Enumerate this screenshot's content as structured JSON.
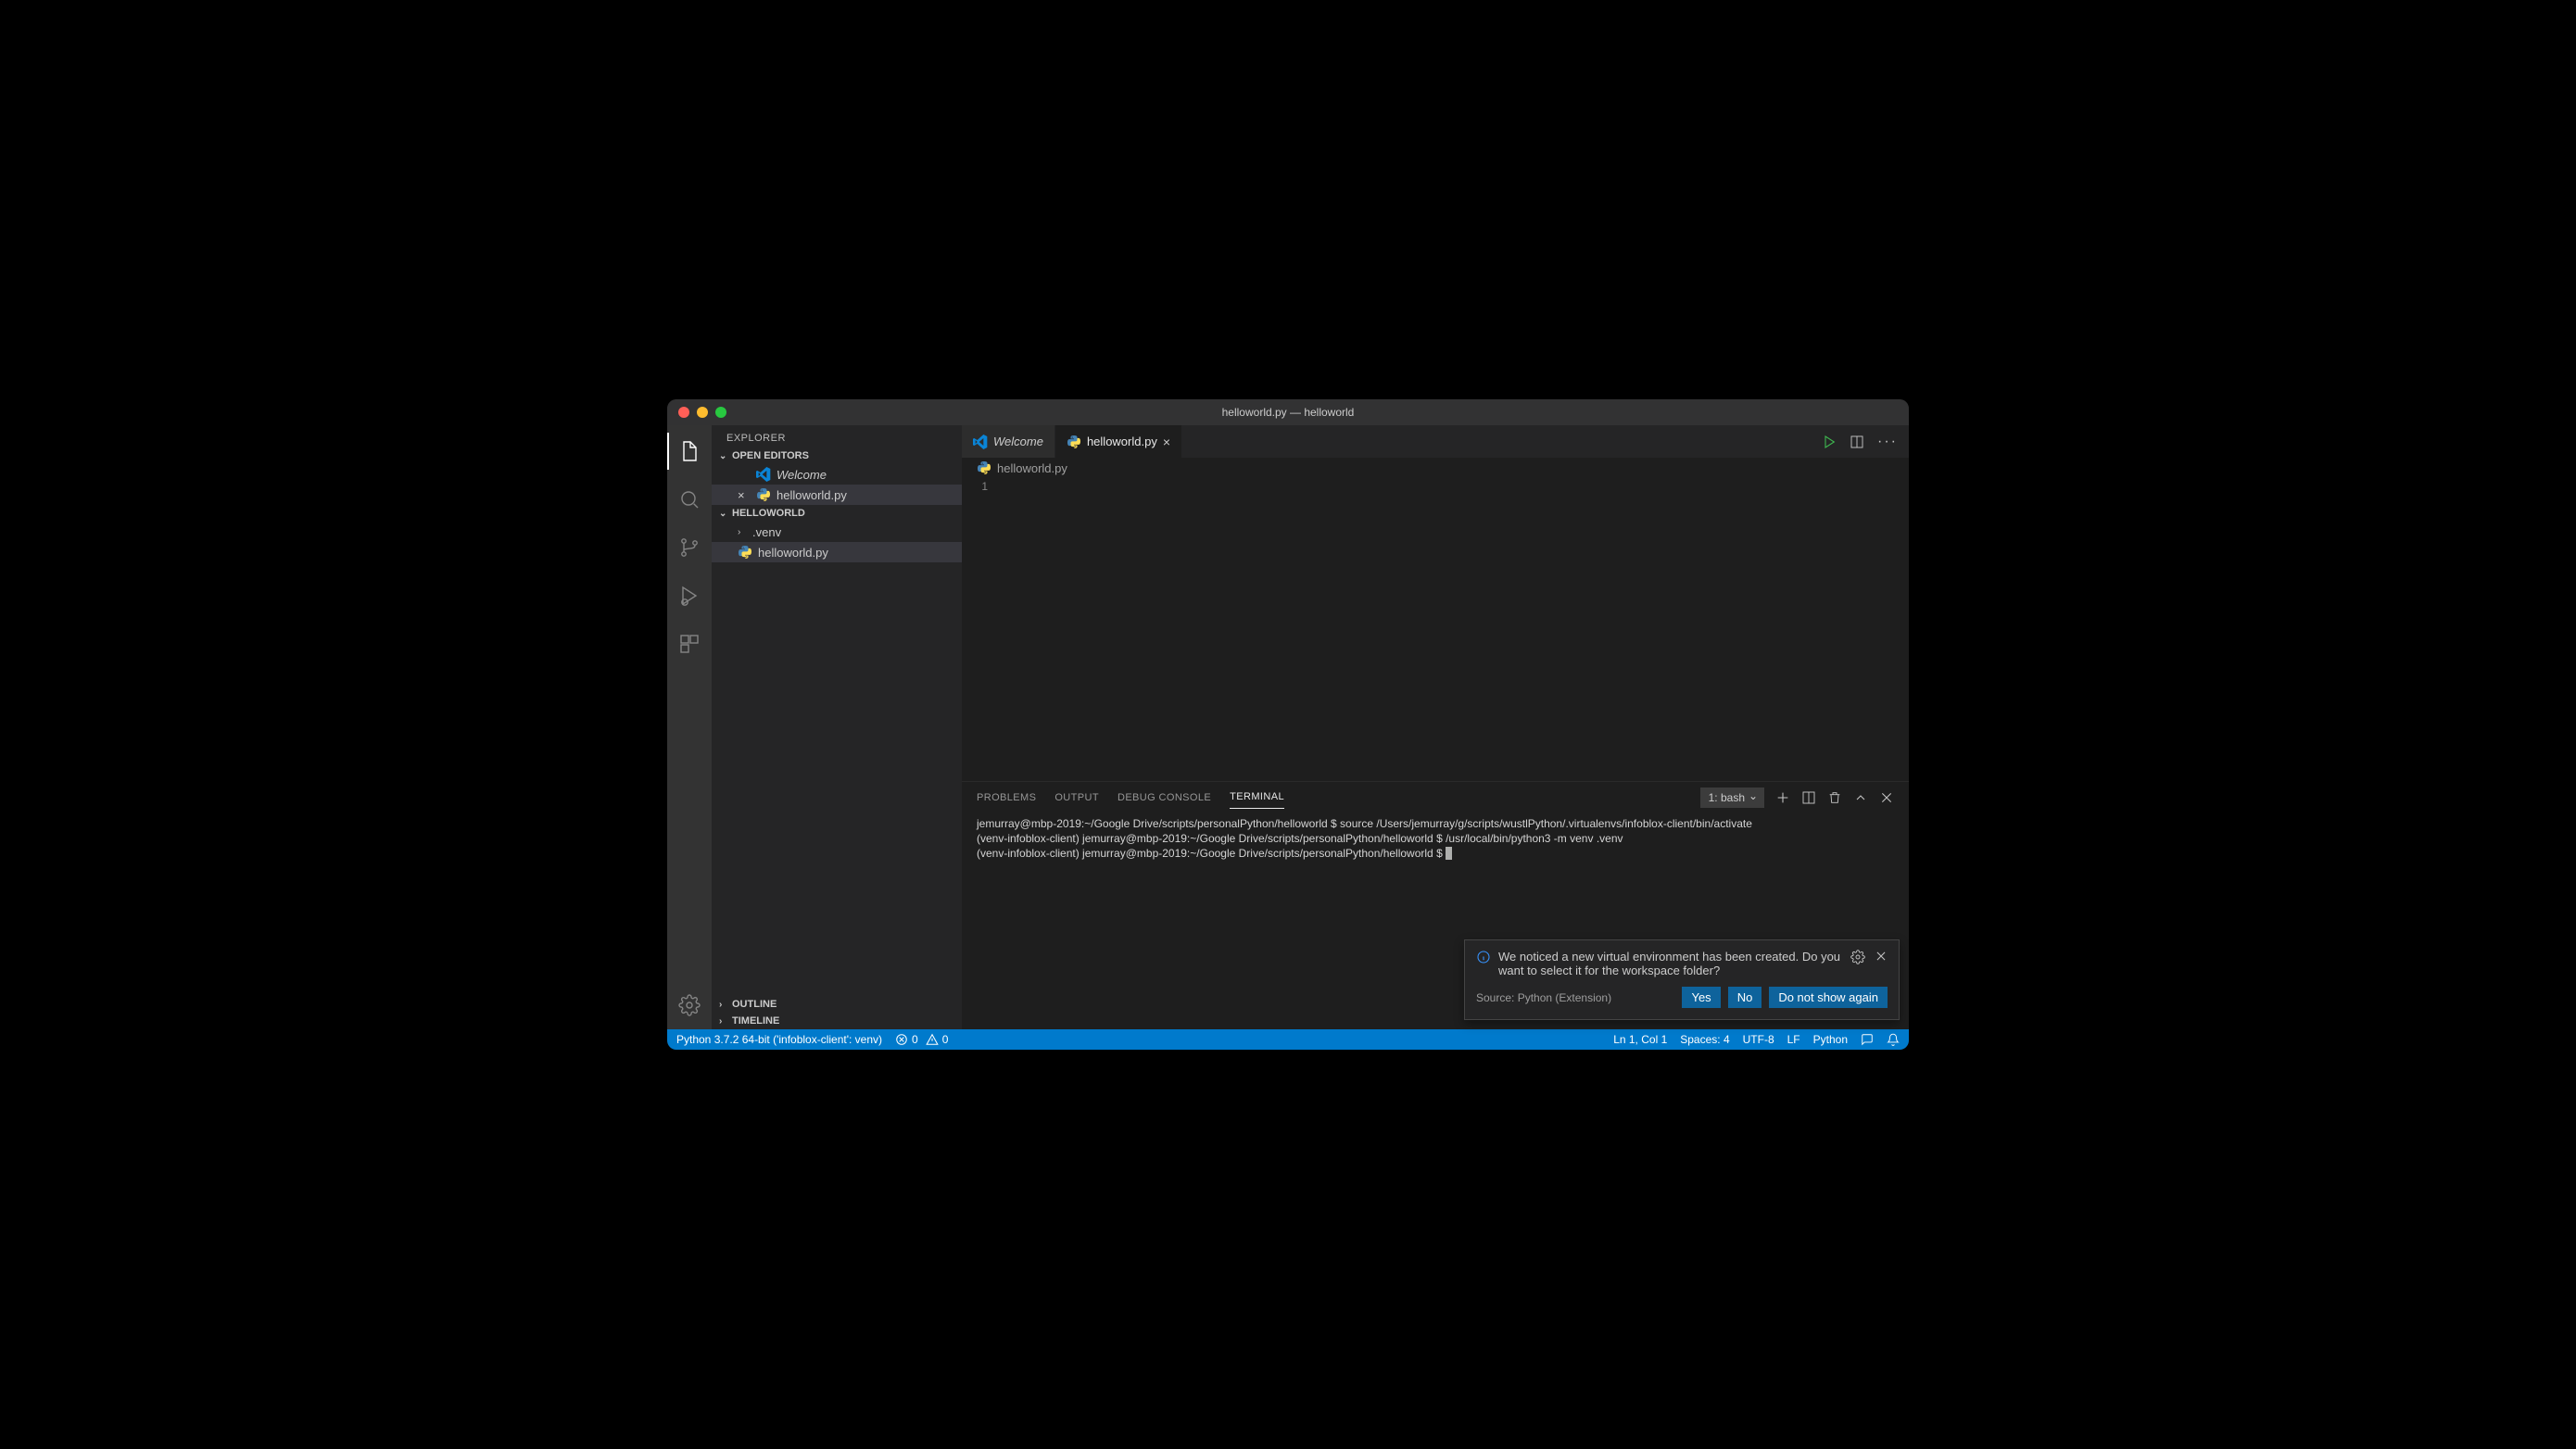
{
  "window": {
    "title": "helloworld.py — helloworld"
  },
  "sidebar": {
    "title": "EXPLORER",
    "openEditors": {
      "label": "OPEN EDITORS",
      "items": [
        {
          "label": "Welcome",
          "italic": true,
          "icon": "vscode"
        },
        {
          "label": "helloworld.py",
          "icon": "python",
          "closeable": true
        }
      ]
    },
    "workspace": {
      "label": "HELLOWORLD",
      "items": [
        {
          "label": ".venv",
          "type": "folder"
        },
        {
          "label": "helloworld.py",
          "type": "file",
          "icon": "python",
          "active": true
        }
      ]
    },
    "outline": {
      "label": "OUTLINE"
    },
    "timeline": {
      "label": "TIMELINE"
    }
  },
  "tabs": {
    "items": [
      {
        "label": "Welcome",
        "italic": true,
        "icon": "vscode"
      },
      {
        "label": "helloworld.py",
        "icon": "python",
        "active": true,
        "closeable": true
      }
    ]
  },
  "breadcrumb": {
    "file": "helloworld.py"
  },
  "editor": {
    "line_numbers": [
      "1"
    ],
    "content": ""
  },
  "panel": {
    "tabs": [
      "PROBLEMS",
      "OUTPUT",
      "DEBUG CONSOLE",
      "TERMINAL"
    ],
    "active": "TERMINAL",
    "terminalSelect": "1: bash",
    "terminal_lines": [
      "jemurray@mbp-2019:~/Google Drive/scripts/personalPython/helloworld $ source /Users/jemurray/g/scripts/wustlPython/.virtualenvs/infoblox-client/bin/activate",
      "(venv-infoblox-client) jemurray@mbp-2019:~/Google Drive/scripts/personalPython/helloworld $ /usr/local/bin/python3 -m venv .venv",
      "(venv-infoblox-client) jemurray@mbp-2019:~/Google Drive/scripts/personalPython/helloworld $ "
    ]
  },
  "notification": {
    "message": "We noticed a new virtual environment has been created. Do you want to select it for the workspace folder?",
    "source": "Source: Python (Extension)",
    "buttons": {
      "yes": "Yes",
      "no": "No",
      "dont": "Do not show again"
    }
  },
  "status": {
    "python": "Python 3.7.2 64-bit ('infoblox-client': venv)",
    "errors": "0",
    "warnings": "0",
    "lncol": "Ln 1, Col 1",
    "spaces": "Spaces: 4",
    "encoding": "UTF-8",
    "eol": "LF",
    "lang": "Python"
  }
}
